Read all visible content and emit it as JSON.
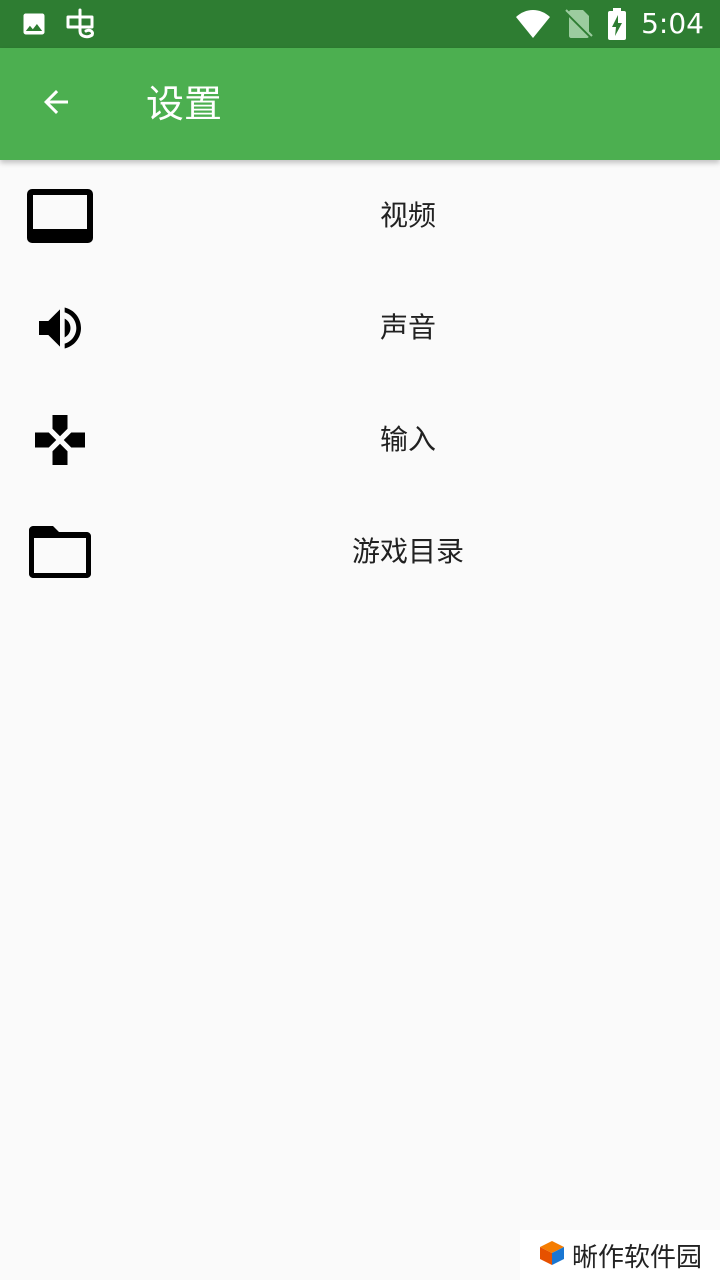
{
  "status_bar": {
    "time": "5:04",
    "left_icons": [
      "image-icon",
      "chong-app-icon"
    ],
    "right_icons": [
      "wifi-icon",
      "no-sim-icon",
      "battery-charging-icon"
    ],
    "background": "#2e7d32"
  },
  "app_bar": {
    "title": "设置",
    "back_icon": "arrow-back-icon",
    "background": "#4caf50"
  },
  "settings": {
    "items": [
      {
        "label": "视频",
        "icon": "display-icon"
      },
      {
        "label": "声音",
        "icon": "volume-up-icon"
      },
      {
        "label": "输入",
        "icon": "gamepad-icon"
      },
      {
        "label": "游戏目录",
        "icon": "folder-icon"
      }
    ]
  },
  "watermark": {
    "text": "晰作软件园"
  }
}
